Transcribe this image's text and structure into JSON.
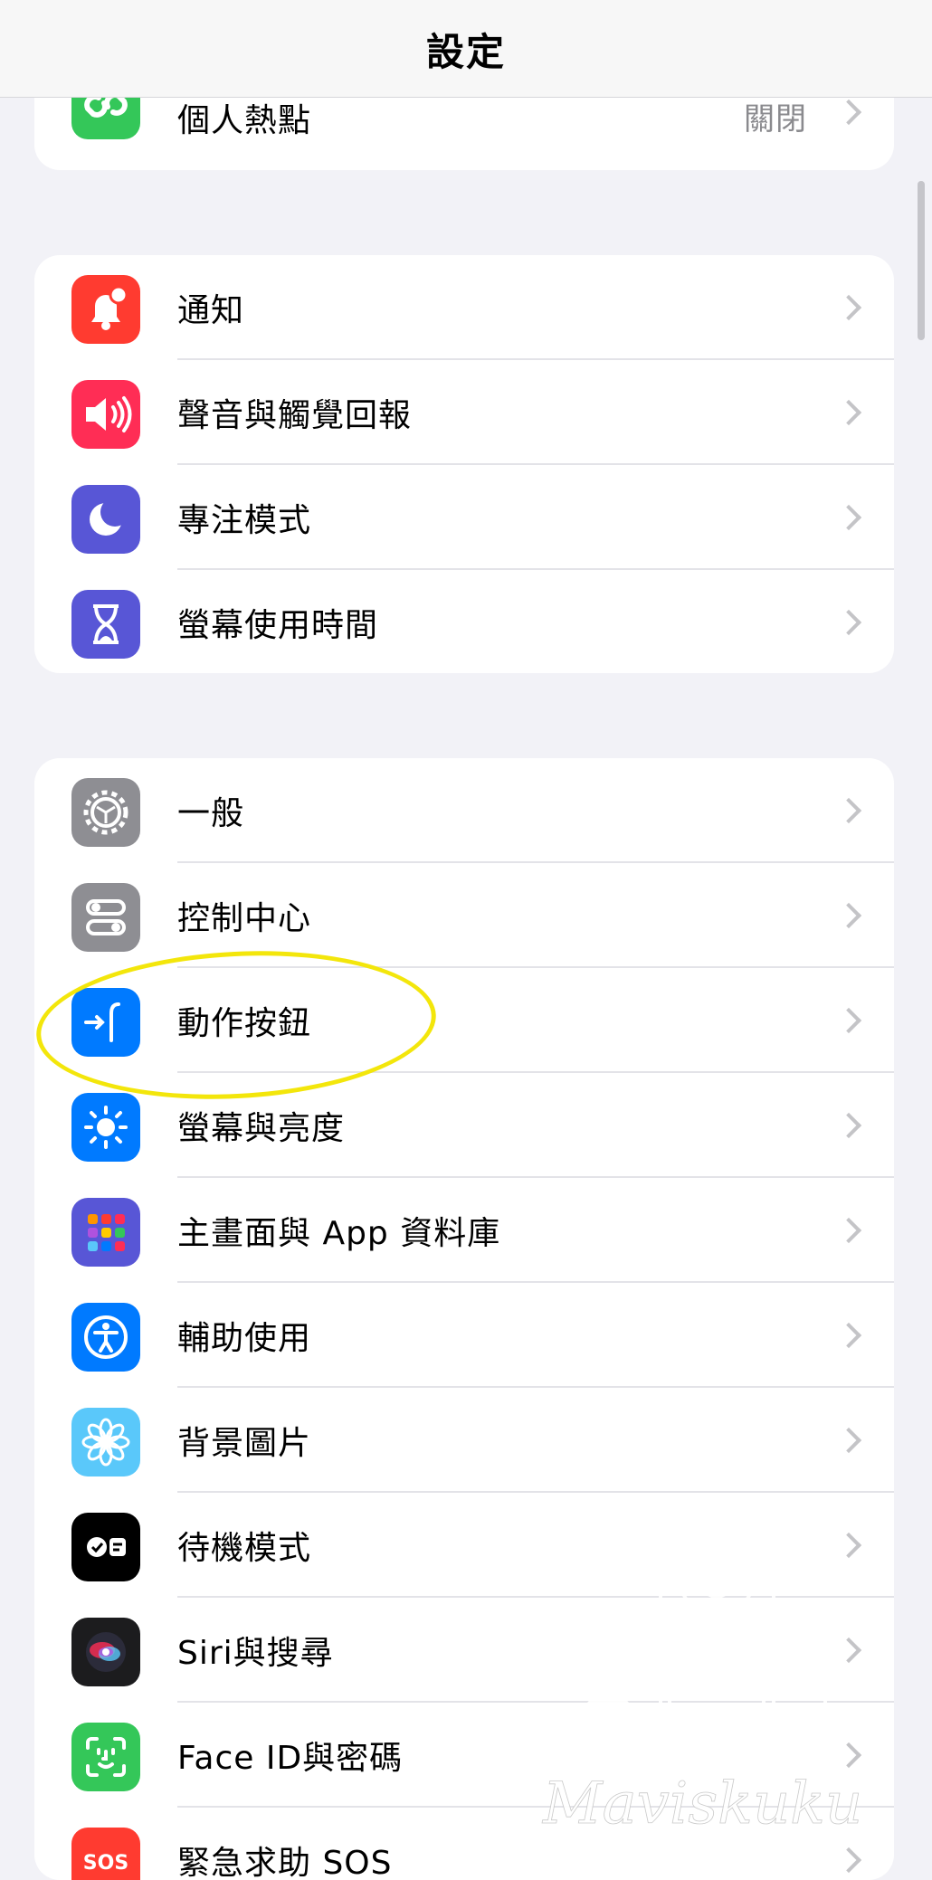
{
  "nav": {
    "title": "設定"
  },
  "group1": {
    "items": [
      {
        "label": "個人熱點",
        "value": "關閉",
        "icon": "personal-hotspot-icon",
        "color": "#34c759"
      }
    ]
  },
  "group2": {
    "items": [
      {
        "label": "通知",
        "icon": "notifications-icon",
        "color": "#ff3b30"
      },
      {
        "label": "聲音與觸覺回報",
        "icon": "sounds-icon",
        "color": "#ff2d55"
      },
      {
        "label": "專注模式",
        "icon": "focus-moon-icon",
        "color": "#5856d6"
      },
      {
        "label": "螢幕使用時間",
        "icon": "hourglass-icon",
        "color": "#5856d6"
      }
    ]
  },
  "group3": {
    "items": [
      {
        "label": "一般",
        "icon": "gear-icon",
        "color": "#8e8e93"
      },
      {
        "label": "控制中心",
        "icon": "control-center-icon",
        "color": "#8e8e93"
      },
      {
        "label": "動作按鈕",
        "icon": "action-button-icon",
        "color": "#007aff"
      },
      {
        "label": "螢幕與亮度",
        "icon": "brightness-icon",
        "color": "#007aff"
      },
      {
        "label": "主畫面與 App 資料庫",
        "icon": "home-screen-icon",
        "color": "#5856d6"
      },
      {
        "label": "輔助使用",
        "icon": "accessibility-icon",
        "color": "#007aff"
      },
      {
        "label": "背景圖片",
        "icon": "wallpaper-flower-icon",
        "color": "#5ac8fa"
      },
      {
        "label": "待機模式",
        "icon": "standby-icon",
        "color": "#000000"
      },
      {
        "label": "Siri與搜尋",
        "icon": "siri-icon",
        "color": "#1c1c1e"
      },
      {
        "label": "Face ID與密碼",
        "icon": "face-id-icon",
        "color": "#34c759"
      },
      {
        "label": "緊急求助 SOS",
        "icon": "sos-icon",
        "color": "#ff3b30"
      }
    ]
  },
  "watermark": {
    "text": "Maviskuku"
  }
}
